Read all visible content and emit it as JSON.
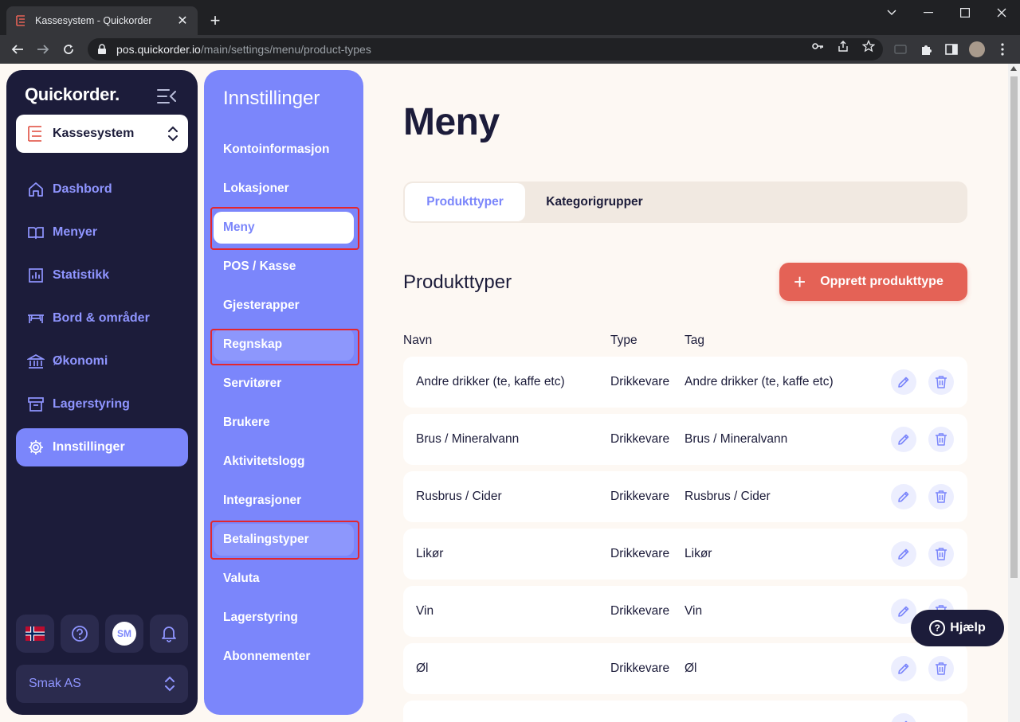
{
  "browser": {
    "tab_title": "Kassesystem - Quickorder",
    "url_host": "pos.quickorder.io",
    "url_path": "/main/settings/menu/product-types"
  },
  "app": {
    "brand": "Quickorder.",
    "system_selector": "Kassesystem",
    "nav": [
      {
        "label": "Dashbord",
        "icon": "home-icon"
      },
      {
        "label": "Menyer",
        "icon": "book-icon"
      },
      {
        "label": "Statistikk",
        "icon": "chart-icon"
      },
      {
        "label": "Bord & områder",
        "icon": "table-icon"
      },
      {
        "label": "Økonomi",
        "icon": "bank-icon"
      },
      {
        "label": "Lagerstyring",
        "icon": "archive-icon"
      },
      {
        "label": "Innstillinger",
        "icon": "gear-icon",
        "active": true
      }
    ],
    "avatar_initials": "SM",
    "company": "Smak AS"
  },
  "settings": {
    "title": "Innstillinger",
    "items": [
      "Kontoinformasjon",
      "Lokasjoner",
      "Meny",
      "POS / Kasse",
      "Gjesterapper",
      "Regnskap",
      "Servitører",
      "Brukere",
      "Aktivitetslogg",
      "Integrasjoner",
      "Betalingstyper",
      "Valuta",
      "Lagerstyring",
      "Abonnementer"
    ],
    "active": "Meny"
  },
  "main": {
    "title": "Meny",
    "tabs": [
      "Produkttyper",
      "Kategorigrupper"
    ],
    "section_title": "Produkttyper",
    "create_button": "Opprett produkttype",
    "columns": [
      "Navn",
      "Type",
      "Tag"
    ],
    "rows": [
      {
        "name": "Andre drikker (te, kaffe etc)",
        "type": "Drikkevare",
        "tag": "Andre drikker (te, kaffe etc)"
      },
      {
        "name": "Brus / Mineralvann",
        "type": "Drikkevare",
        "tag": "Brus / Mineralvann"
      },
      {
        "name": "Rusbrus / Cider",
        "type": "Drikkevare",
        "tag": "Rusbrus / Cider"
      },
      {
        "name": "Likør",
        "type": "Drikkevare",
        "tag": "Likør"
      },
      {
        "name": "Vin",
        "type": "Drikkevare",
        "tag": "Vin"
      },
      {
        "name": "Øl",
        "type": "Drikkevare",
        "tag": "Øl"
      }
    ]
  },
  "help_button": "Hjælp",
  "colors": {
    "navy": "#1c1c3a",
    "periwinkle": "#7b86fb",
    "coral": "#e46256",
    "cream": "#fdf8f3",
    "highlight": "#e3262e"
  }
}
